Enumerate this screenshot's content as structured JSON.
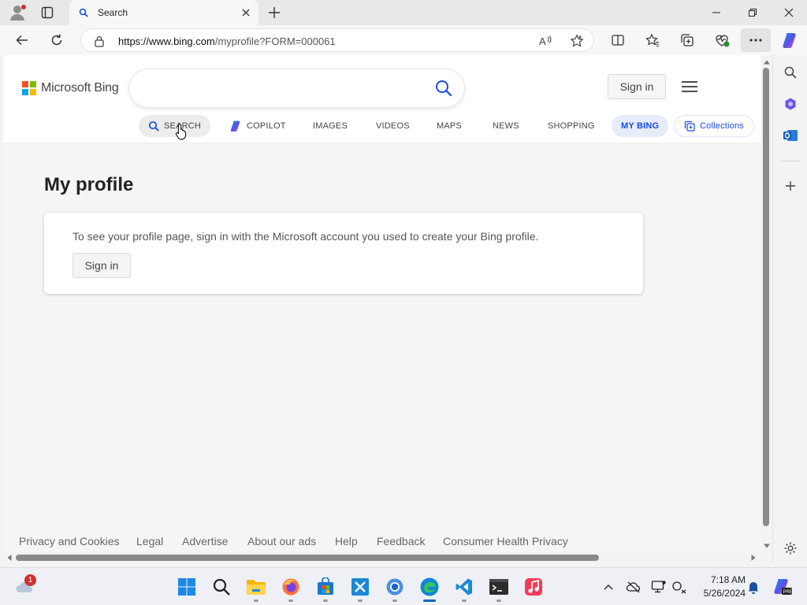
{
  "browser": {
    "tab": {
      "title": "Search"
    },
    "address_bar": {
      "url_prefix": "https://www.bing.com",
      "url_path": "/myprofile?FORM=000061"
    }
  },
  "bing": {
    "logo_text": "Microsoft Bing",
    "search": {
      "value": "",
      "placeholder": ""
    },
    "sign_in_label": "Sign in",
    "scopes": {
      "search": "SEARCH",
      "copilot": "COPILOT",
      "images": "IMAGES",
      "videos": "VIDEOS",
      "maps": "MAPS",
      "news": "NEWS",
      "shopping": "SHOPPING",
      "my_bing": "MY BING",
      "collections": "Collections"
    },
    "active_scope": "MY BING"
  },
  "main": {
    "title": "My profile",
    "card": {
      "message": "To see your profile page, sign in with the Microsoft account you used to create your Bing profile.",
      "sign_in_label": "Sign in"
    }
  },
  "footer": {
    "links": [
      "Privacy and Cookies",
      "Legal",
      "Advertise",
      "About our ads",
      "Help",
      "Feedback",
      "Consumer Health Privacy"
    ]
  },
  "taskbar": {
    "weather_badge": "1",
    "clock": {
      "time": "7:18 AM",
      "date": "5/26/2024"
    }
  },
  "colors": {
    "accent": "#174ae4",
    "ms_red": "#f25022",
    "ms_green": "#7fba00",
    "ms_blue": "#00a4ef",
    "ms_yellow": "#ffb900"
  }
}
